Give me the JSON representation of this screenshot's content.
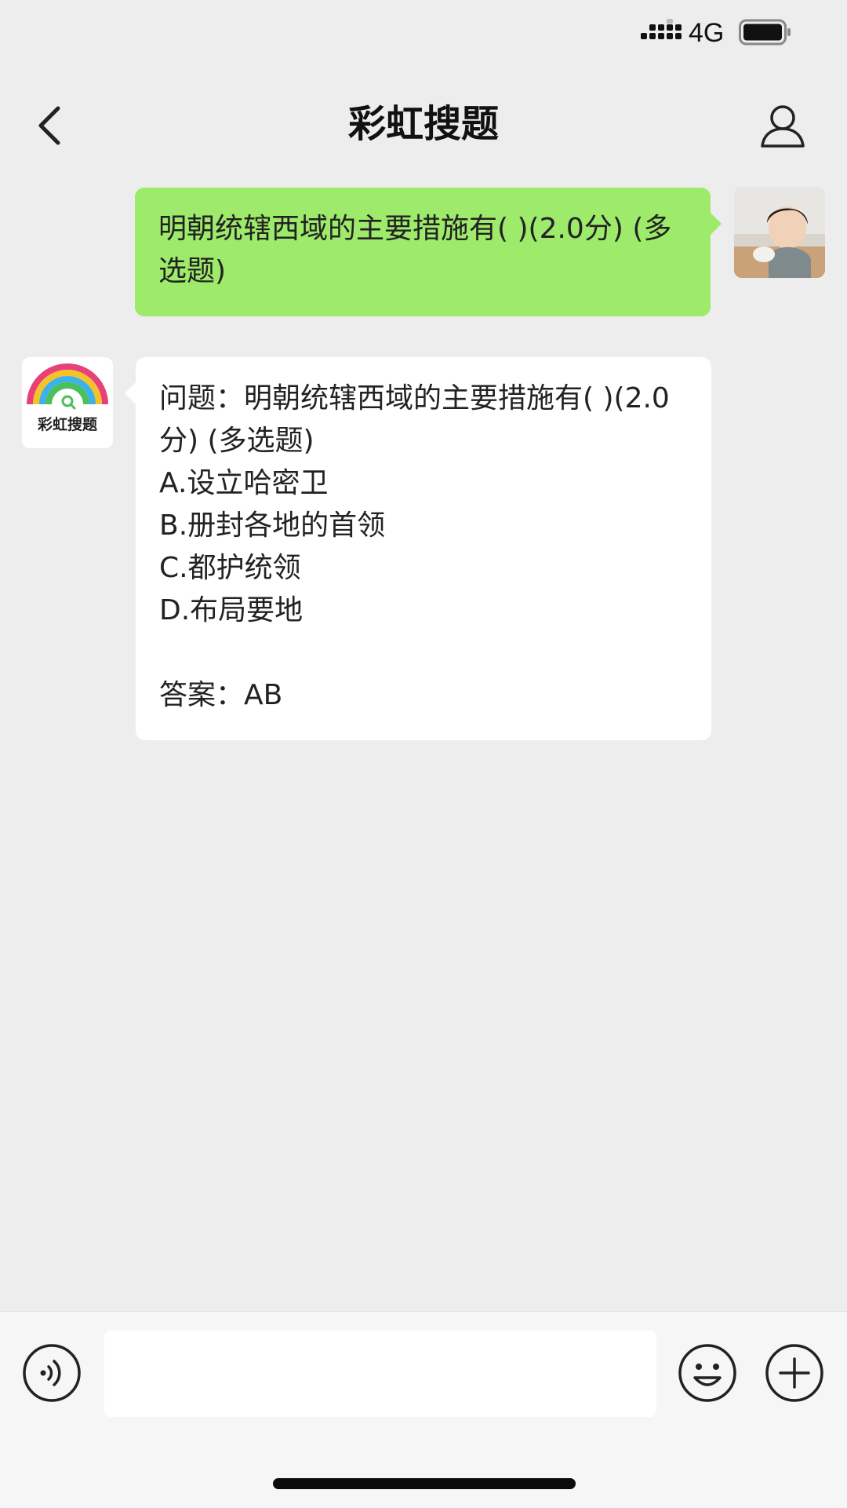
{
  "status_bar": {
    "network": "4G",
    "icons": [
      "signal-icon",
      "battery-icon"
    ]
  },
  "header": {
    "title": "彩虹搜题",
    "icons": [
      "back-arrow-icon",
      "profile-icon"
    ]
  },
  "messages": {
    "user": {
      "text": "明朝统辖西域的主要措施有( )(2.0分) (多选题)"
    },
    "bot": {
      "logo_text": "彩虹搜题",
      "question": "问题：明朝统辖西域的主要措施有( )(2.0分) (多选题)",
      "options": [
        "A.设立哈密卫",
        "B.册封各地的首领",
        "C.都护统领",
        "D.布局要地"
      ],
      "answer": "答案：AB"
    }
  },
  "input_bar": {
    "message_value": "",
    "icons": [
      "voice-icon",
      "emoji-icon",
      "plus-icon"
    ]
  },
  "colors": {
    "background": "#ededed",
    "user_bubble": "#9eea6a",
    "bot_bubble": "#ffffff"
  }
}
